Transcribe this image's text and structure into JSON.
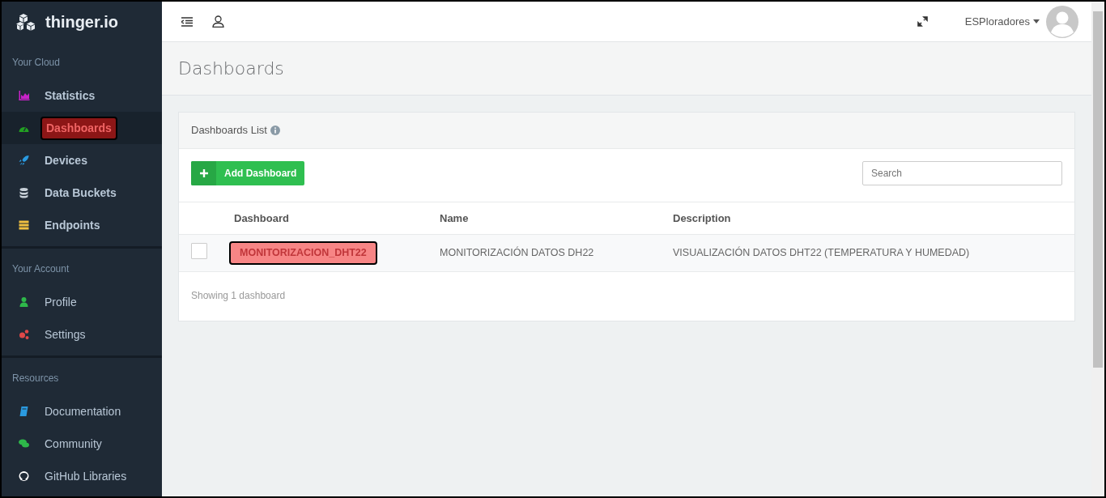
{
  "brand": "thinger.io",
  "sidebar": [
    {
      "heading": "Your Cloud",
      "items": [
        {
          "label": "Statistics",
          "color": "#c822c8",
          "selected": false
        },
        {
          "label": "Dashboards",
          "color": "#22a022",
          "selected": true
        },
        {
          "label": "Devices",
          "color": "#2a9ae0",
          "selected": false
        },
        {
          "label": "Data Buckets",
          "color": "#c8d0d8",
          "selected": false
        },
        {
          "label": "Endpoints",
          "color": "#f0c040",
          "selected": false
        }
      ]
    },
    {
      "heading": "Your Account",
      "items": [
        {
          "label": "Profile",
          "color": "#2eb84a",
          "selected": false
        },
        {
          "label": "Settings",
          "color": "#e04848",
          "selected": false
        }
      ]
    },
    {
      "heading": "Resources",
      "items": [
        {
          "label": "Documentation",
          "color": "#2a9ae0",
          "selected": false
        },
        {
          "label": "Community",
          "color": "#2eb84a",
          "selected": false
        },
        {
          "label": "GitHub Libraries",
          "color": "#ffffff",
          "selected": false
        }
      ]
    }
  ],
  "user": {
    "name": "ESPloradores"
  },
  "page_title": "Dashboards",
  "card": {
    "title": "Dashboards List",
    "add_button": "Add Dashboard",
    "search": {
      "placeholder": "Search"
    },
    "table": {
      "columns": [
        "Dashboard",
        "Name",
        "Description"
      ],
      "rows": [
        {
          "checked": false,
          "dashboard": "MONITORIZACION_DHT22",
          "name": "MONITORIZACIÓN DATOS DH22",
          "description": "VISUALIZACIÓN DATOS DHT22 (TEMPERATURA Y HUMEDAD)"
        }
      ]
    },
    "footer": "Showing 1 dashboard"
  }
}
